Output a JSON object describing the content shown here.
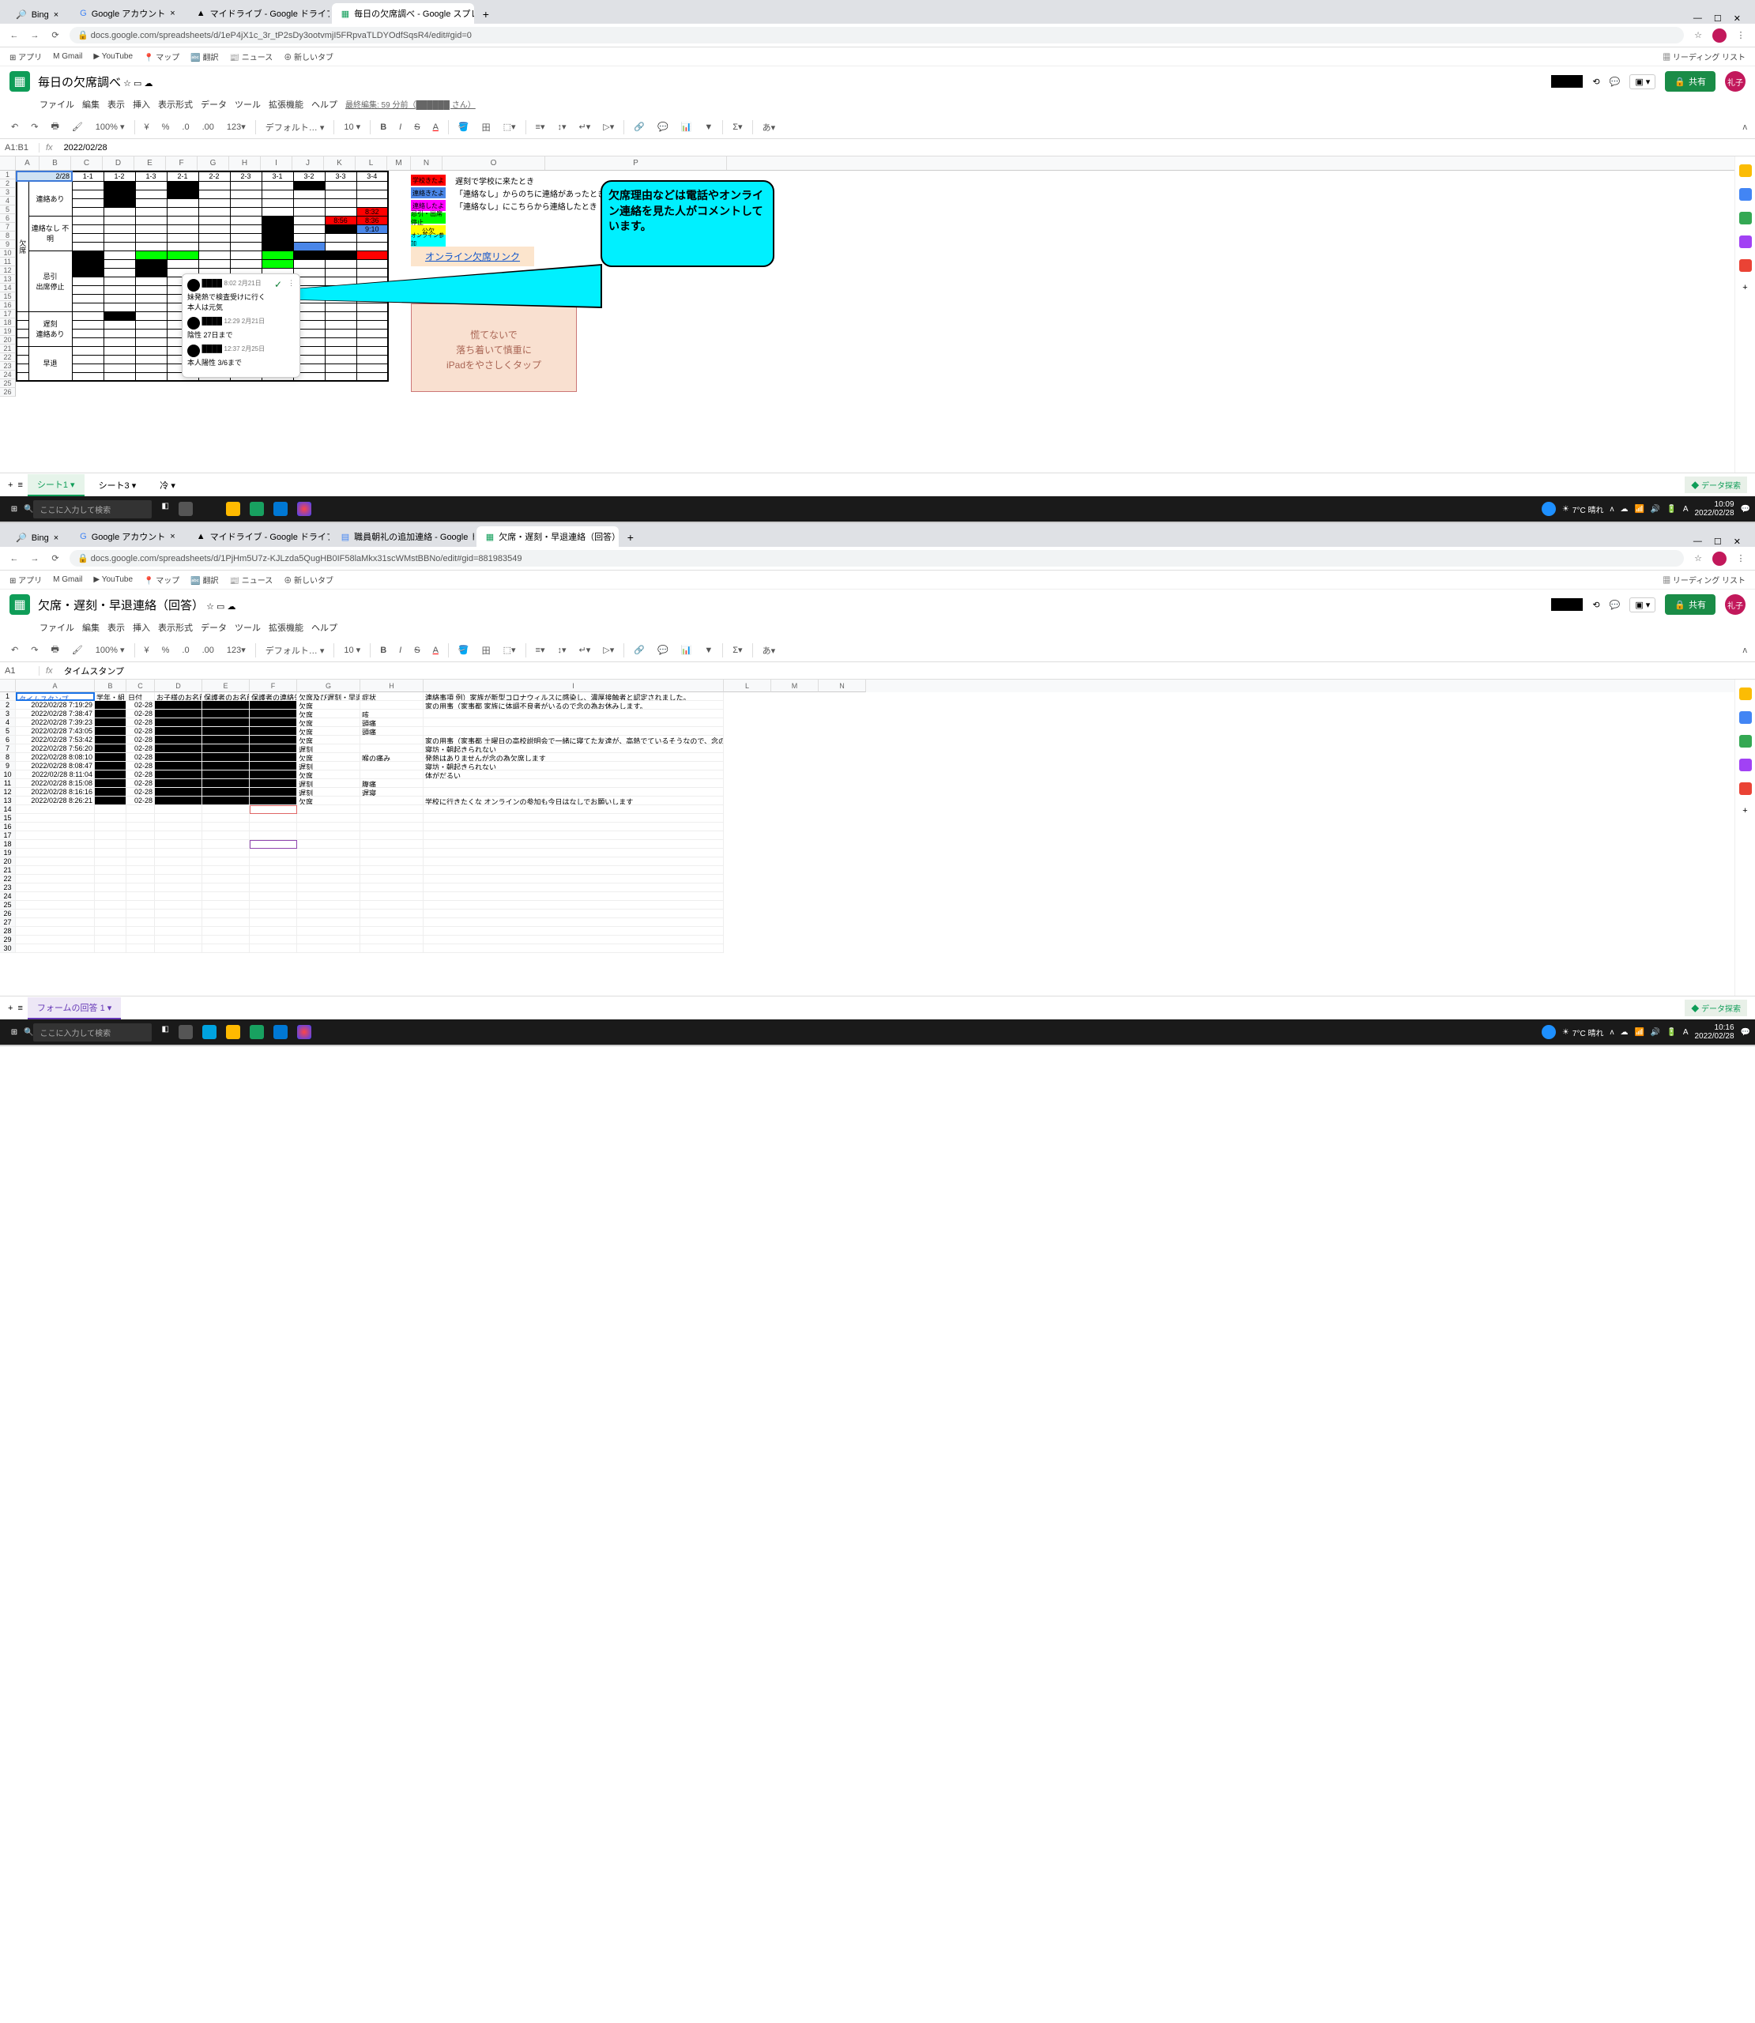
{
  "win1": {
    "tabs": [
      "Bing",
      "Google アカウント",
      "マイドライブ - Google ドライブ",
      "毎日の欠席調べ - Google スプレ…"
    ],
    "url": "docs.google.com/spreadsheets/d/1eP4jX1c_3r_tP2sDy3ootvmjI5FRpvaTLDYOdfSqsR4/edit#gid=0",
    "bookmarks": [
      "アプリ",
      "Gmail",
      "YouTube",
      "マップ",
      "翻訳",
      "ニュース",
      "新しいタブ"
    ],
    "readingList": "リーディング リスト",
    "docTitle": "毎日の欠席調べ",
    "menus": [
      "ファイル",
      "編集",
      "表示",
      "挿入",
      "表示形式",
      "データ",
      "ツール",
      "拡張機能",
      "ヘルプ"
    ],
    "lastEdit": "最終編集: 59 分前（██████ さん）",
    "share": "共有",
    "avatar": "礼子",
    "toolbar": {
      "zoom": "100%",
      "currency": "¥",
      "pct": "%",
      "dec0": ".0",
      "dec00": ".00",
      "num": "123",
      "font": "デフォルト…",
      "size": "10",
      "more": "あ"
    },
    "cellRef": "A1:B1",
    "formula": "2022/02/28",
    "colLetters": [
      "A",
      "B",
      "C",
      "D",
      "E",
      "F",
      "G",
      "H",
      "I",
      "J",
      "K",
      "L",
      "M",
      "N",
      "O",
      "P"
    ],
    "rowNums": [
      "1",
      "2",
      "3",
      "4",
      "5",
      "6",
      "7",
      "8",
      "9",
      "10",
      "11",
      "12",
      "13",
      "14",
      "15",
      "16",
      "17",
      "18",
      "19",
      "20",
      "21",
      "22",
      "23",
      "24",
      "25",
      "26"
    ],
    "topDate": "2/28",
    "classCols": [
      "1-1",
      "1-2",
      "1-3",
      "2-1",
      "2-2",
      "2-3",
      "3-1",
      "3-2",
      "3-3",
      "3-4"
    ],
    "rowGroups": {
      "g0": "欠席",
      "r1": "連絡あり",
      "r2": "連絡なし\n不明",
      "r3": "忌引\n出席停止",
      "r4": "遅刻\n連絡あり",
      "r5": "早退"
    },
    "legend": {
      "l1": {
        "t": "学校きたよ",
        "d": "遅刻で学校に来たとき"
      },
      "l2": {
        "t": "連絡きたよ",
        "d": "「連絡なし」からのちに連絡があったとき"
      },
      "l3": {
        "t": "連絡したよ",
        "d": "「連絡なし」にこちらから連絡したとき"
      },
      "l4": {
        "t": "忌引・出席停止",
        "d": ""
      },
      "l5": {
        "t": "公欠",
        "d": ""
      },
      "l6": {
        "t": "オンライン参加\n出席扱い",
        "d": ""
      }
    },
    "onlineLink": "オンライン欠席リンク",
    "comments": {
      "c1": {
        "time": "8:02 2月21日",
        "text": "妹発熱で検査受けに行く\n本人は元気"
      },
      "c2": {
        "time": "12:29 2月21日",
        "text": "陰性 27日まで"
      },
      "c3": {
        "time": "12:37 2月25日",
        "text": "本人陽性 3/6まで"
      }
    },
    "callout": "欠席理由などは電話やオンライン連絡を見た人がコメントしています。",
    "peach": {
      "l1": "慌てないで",
      "l2": "落ち着いて慎重に",
      "l3": "iPadをやさしくタップ"
    },
    "sheetTabs": [
      "シート1",
      "シート3",
      "冷"
    ],
    "explore": "データ探索",
    "taskbar": {
      "search": "ここに入力して検索",
      "weather": "7°C 晴れ",
      "time": "10:09",
      "date": "2022/02/28"
    }
  },
  "win2": {
    "tabs": [
      "Bing",
      "Google アカウント",
      "マイドライブ - Google ドライブ",
      "職員朝礼の追加連絡 - Google ド…",
      "欠席・遅刻・早退連絡（回答）- …"
    ],
    "url": "docs.google.com/spreadsheets/d/1PjHm5U7z-KJLzda5QugHB0IF58laMkx31scWMstBBNo/edit#gid=881983549",
    "docTitle": "欠席・遅刻・早退連絡（回答）",
    "cellRef": "A1",
    "formula": "タイムスタンプ",
    "headers": [
      "タイムスタンプ",
      "学年・組",
      "日付",
      "お子様のお名前",
      "保護者のお名前",
      "保護者の連絡先",
      "欠席及び遅刻・早退",
      "症状",
      "連絡事項 例）家族が新型コロナウィルスに感染し、濃厚接触者と認定されました。"
    ],
    "rows": [
      {
        "ts": "2022/02/28 7:19:29",
        "date": "02-28",
        "k": "欠席",
        "s": "",
        "m": "家の用事（家事都 家族に体調不良者がいるので念の為お休みします。"
      },
      {
        "ts": "2022/02/28 7:38:47",
        "date": "02-28",
        "k": "欠席",
        "s": "咳",
        "m": ""
      },
      {
        "ts": "2022/02/28 7:39:23",
        "date": "02-28",
        "k": "欠席",
        "s": "頭痛",
        "m": ""
      },
      {
        "ts": "2022/02/28 7:43:05",
        "date": "02-28",
        "k": "欠席",
        "s": "頭痛",
        "m": ""
      },
      {
        "ts": "2022/02/28 7:53:42",
        "date": "02-28",
        "k": "欠席",
        "s": "",
        "m": "家の用事（家事都 土曜日の高校説明会で一緒に寝てた友達が、高熱でているそうなので、念の為お休みさせます。"
      },
      {
        "ts": "2022/02/28 7:56:20",
        "date": "02-28",
        "k": "遅刻",
        "s": "",
        "m": "寝坊・朝起きられない"
      },
      {
        "ts": "2022/02/28 8:08:10",
        "date": "02-28",
        "k": "欠席",
        "s": "喉の痛み",
        "m": "発熱はありませんが念の為欠席します"
      },
      {
        "ts": "2022/02/28 8:08:47",
        "date": "02-28",
        "k": "遅刻",
        "s": "",
        "m": "寝坊・朝起きられない"
      },
      {
        "ts": "2022/02/28 8:11:04",
        "date": "02-28",
        "k": "欠席",
        "s": "",
        "m": "体がだるい"
      },
      {
        "ts": "2022/02/28 8:15:08",
        "date": "02-28",
        "k": "遅刻",
        "s": "腹痛",
        "m": ""
      },
      {
        "ts": "2022/02/28 8:16:16",
        "date": "02-28",
        "k": "遅刻",
        "s": "遅寝",
        "m": ""
      },
      {
        "ts": "2022/02/28 8:26:21",
        "date": "02-28",
        "k": "欠席",
        "s": "",
        "m": "学校に行きたくな オンラインの参加も今日はなしでお願いします"
      }
    ],
    "sheetTab": "フォームの回答 1",
    "taskbar": {
      "time": "10:16",
      "date": "2022/02/28"
    }
  }
}
